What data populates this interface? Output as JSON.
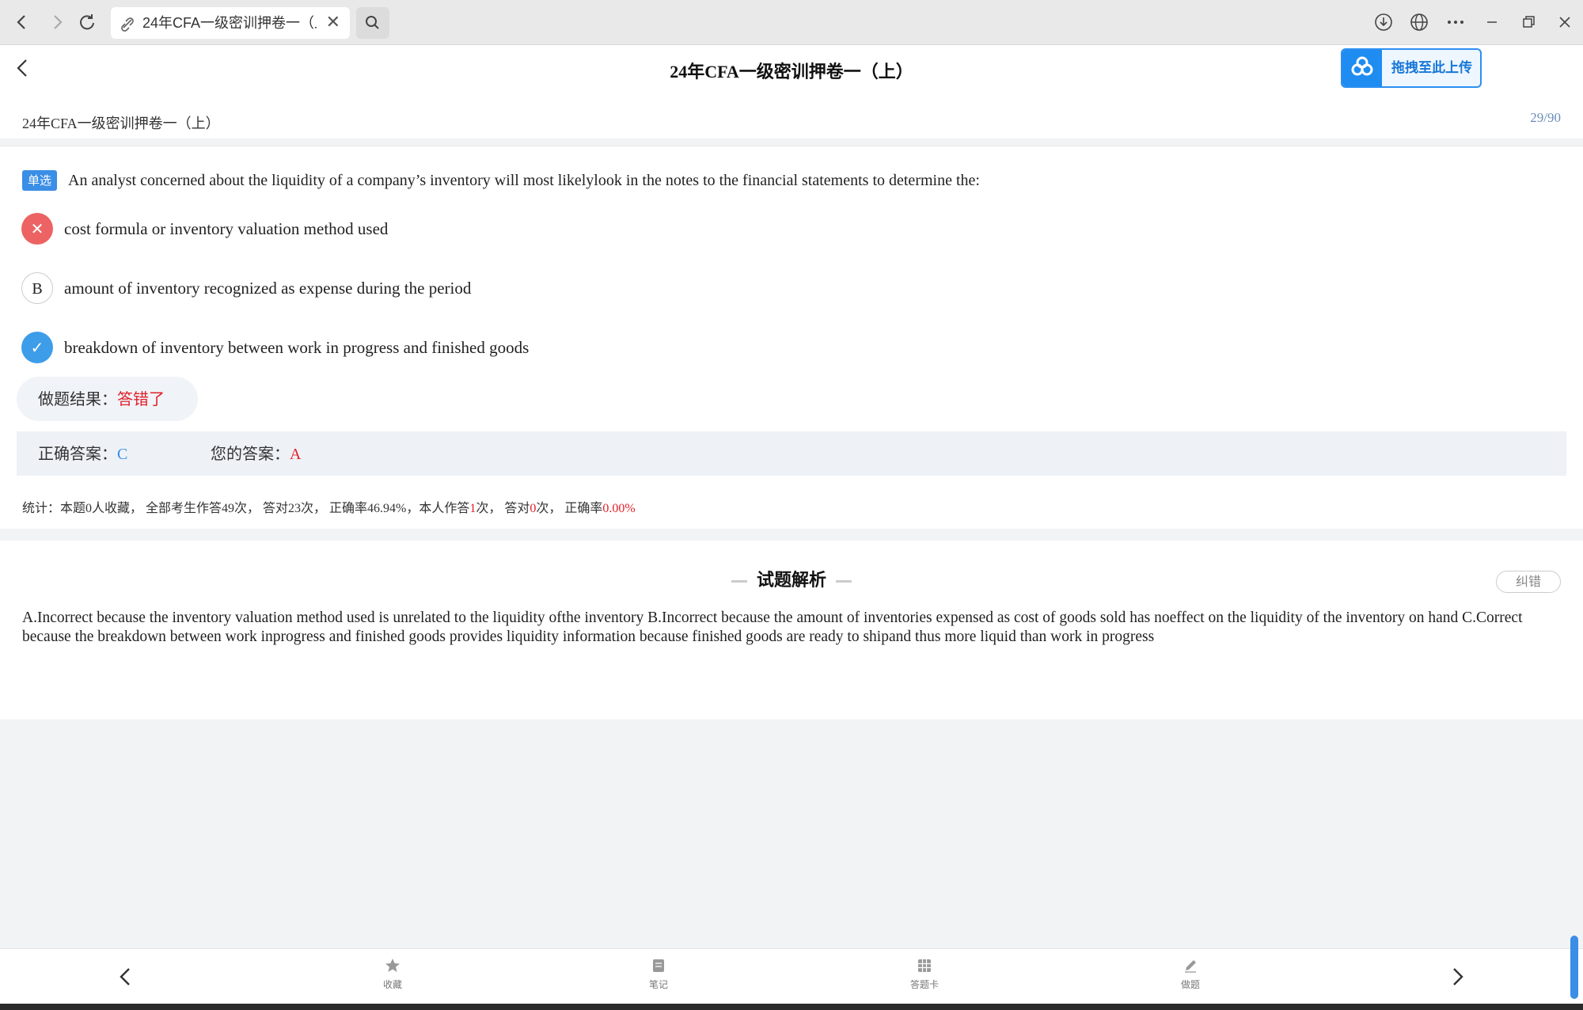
{
  "browser": {
    "tab_title": "24年CFA一级密训押卷一（上）",
    "tab_close": "✕"
  },
  "header": {
    "title": "24年CFA一级密训押卷一（上）",
    "upload_label": "拖拽至此上传",
    "exam_name": "24年CFA一级密训押卷一（上）",
    "progress": "29/90"
  },
  "question": {
    "type_badge": "单选",
    "text": "An analyst concerned about the liquidity of a company’s inventory will most likelylook in the notes to the financial statements to determine the:",
    "options": [
      {
        "marker": "✕",
        "text": "cost formula or inventory valuation method used",
        "state": "wrong"
      },
      {
        "marker": "B",
        "text": "amount of inventory recognized as expense during the period",
        "state": "plain"
      },
      {
        "marker": "✓",
        "text": "breakdown of inventory between work in progress and finished goods",
        "state": "correct"
      }
    ]
  },
  "result": {
    "label": "做题结果：",
    "value": "答错了"
  },
  "answers": {
    "correct_label": "正确答案：",
    "correct_value": "C",
    "yours_label": "您的答案：",
    "yours_value": "A"
  },
  "stats": {
    "p1": "统计：本题0人收藏， 全部考生作答49次， 答对23次， 正确率46.94%，本人作答",
    "self_answered": "1",
    "p2": "次， 答对",
    "self_correct": "0",
    "p3": "次， 正确率",
    "self_rate": "0.00%"
  },
  "analysis": {
    "title": "试题解析",
    "fix_label": "纠错",
    "text": "A.Incorrect because the inventory valuation method used is unrelated to the liquidity ofthe inventory B.Incorrect because the amount of inventories expensed as cost of goods sold has noeffect on the liquidity of the inventory on hand C.Correct because the breakdown between work inprogress and finished goods provides liquidity information because finished goods are ready to shipand thus more liquid than work in progress"
  },
  "bottom_nav": {
    "favorite": "收藏",
    "notes": "笔记",
    "answer_card": "答题卡",
    "do_question": "做题"
  },
  "colors": {
    "accent": "#3a8ee6",
    "error": "#e0202a",
    "wrong_circle": "#ed6363"
  }
}
